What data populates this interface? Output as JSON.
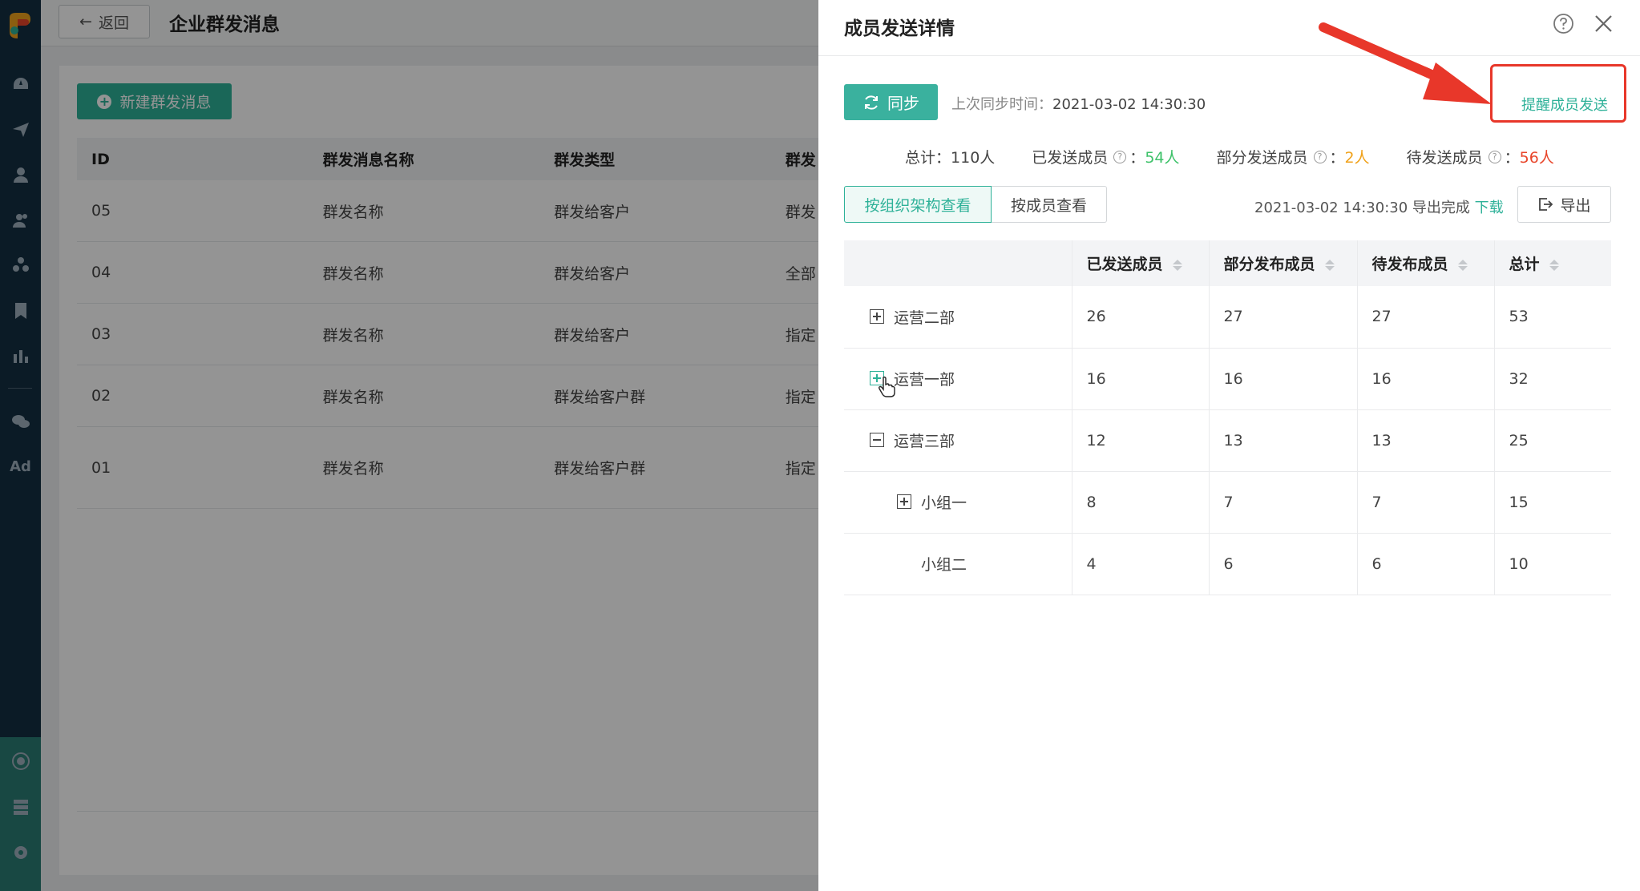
{
  "background_page": {
    "back_label": "返回",
    "title": "企业群发消息",
    "new_button_label": "新建群发消息",
    "table": {
      "headers": [
        "ID",
        "群发消息名称",
        "群发类型",
        "群发"
      ],
      "rows": [
        {
          "id": "05",
          "name": "群发名称",
          "type": "群发给客户",
          "target": "群发"
        },
        {
          "id": "04",
          "name": "群发名称",
          "type": "群发给客户",
          "target": "全部"
        },
        {
          "id": "03",
          "name": "群发名称",
          "type": "群发给客户",
          "target": "指定"
        },
        {
          "id": "02",
          "name": "群发名称",
          "type": "群发给客户群",
          "target": "指定"
        },
        {
          "id": "01",
          "name": "群发名称",
          "type": "群发给客户群",
          "target": "指定"
        }
      ]
    }
  },
  "sidebar": {
    "icons": [
      "dashboard-icon",
      "send-icon",
      "user-icon",
      "users-icon",
      "group-icon",
      "bookmark-icon",
      "chart-icon",
      "wechat-icon",
      "ad-icon",
      "ai-icon",
      "server-icon",
      "settings-icon"
    ],
    "ad_label": "Ad"
  },
  "drawer": {
    "title": "成员发送详情",
    "sync_label": "同步",
    "last_sync_label": "上次同步时间：",
    "last_sync_time": "2021-03-02 14:30:30",
    "remind_label": "提醒成员发送",
    "stats": {
      "total_label": "总计：",
      "total_value": "110人",
      "sent_label": "已发送成员",
      "sent_value": "54人",
      "partial_label": "部分发送成员",
      "partial_value": "2人",
      "pending_label": "待发送成员",
      "pending_value": "56人"
    },
    "tabs": [
      "按组织架构查看",
      "按成员查看"
    ],
    "export_time": "2021-03-02 14:30:30",
    "export_done": "导出完成",
    "download_label": "下载",
    "export_label": "导出",
    "table": {
      "headers": [
        "",
        "已发送成员",
        "部分发布成员",
        "待发布成员",
        "总计"
      ],
      "rows": [
        {
          "name": "运营二部",
          "sent": "26",
          "partial": "27",
          "pending": "27",
          "total": "53"
        },
        {
          "name": "运营一部",
          "sent": "16",
          "partial": "16",
          "pending": "16",
          "total": "32"
        },
        {
          "name": "运营三部",
          "sent": "12",
          "partial": "13",
          "pending": "13",
          "total": "25"
        },
        {
          "name": "小组一",
          "sent": "8",
          "partial": "7",
          "pending": "7",
          "total": "15"
        },
        {
          "name": "小组二",
          "sent": "4",
          "partial": "6",
          "pending": "6",
          "total": "10"
        }
      ]
    }
  },
  "colors": {
    "accent": "#2eb198",
    "sidebar": "#143043",
    "highlight": "#e8372a"
  }
}
